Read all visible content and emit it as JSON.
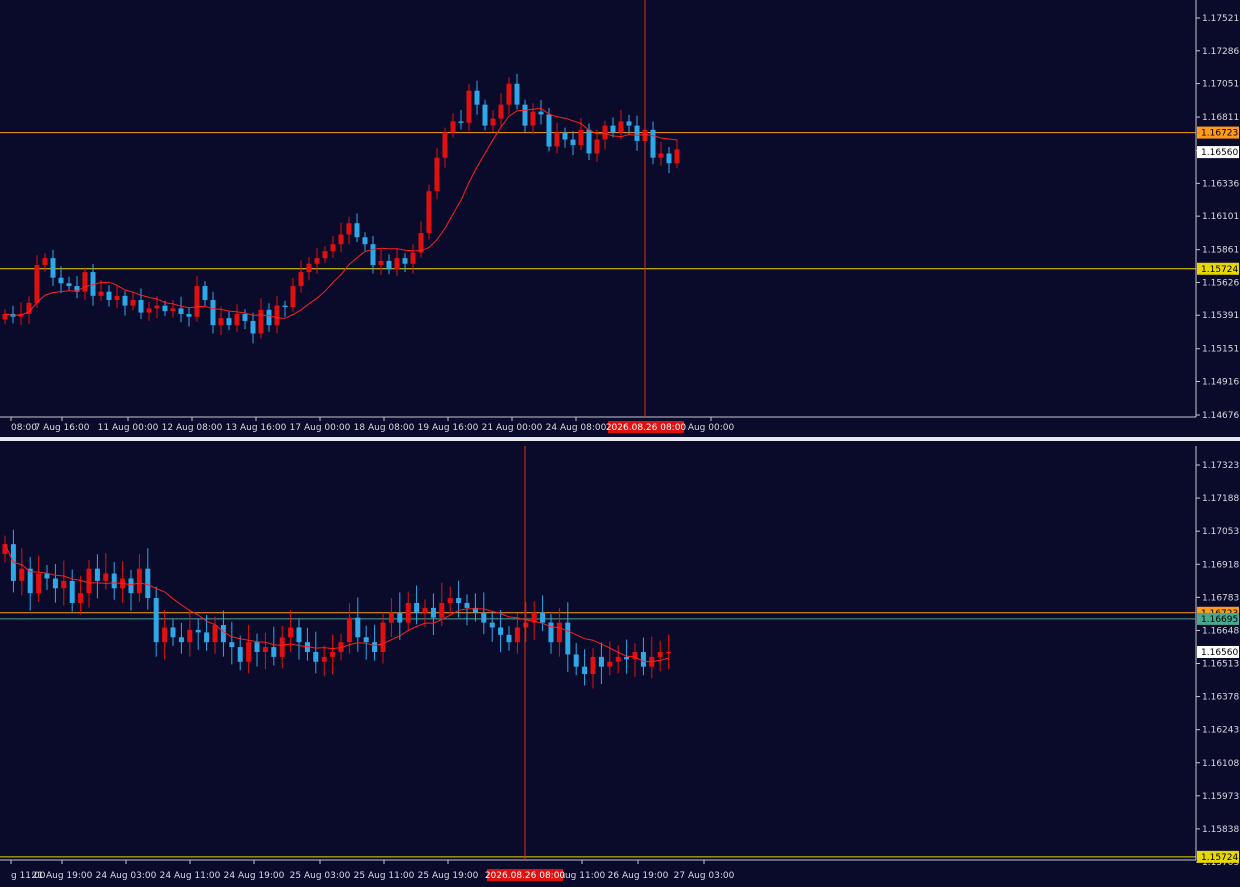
{
  "colors": {
    "background": "#0a0a2a",
    "grid_frame": "#c8c8d0",
    "bull_candle": "#e01010",
    "bear_candle": "#30a8e8",
    "moving_average": "#ff2020",
    "crosshair": "#e03010",
    "level_orange": "#ff9a1a",
    "level_yellow": "#e8d800",
    "level_green": "#4aa890",
    "price_tag_white": "#ffffff",
    "date_tag": "#e01010"
  },
  "chart_data": [
    {
      "type": "candlestick",
      "pane": "top",
      "y_ticks": [
        "1.17521",
        "1.17286",
        "1.17051",
        "1.16811",
        "1.16571",
        "1.16336",
        "1.16101",
        "1.15861",
        "1.15626",
        "1.15391",
        "1.15151",
        "1.14916",
        "1.14676"
      ],
      "ylim": [
        1.14676,
        1.17521
      ],
      "x_ticks": [
        "08:00",
        "7 Aug 16:00",
        "11 Aug 00:00",
        "12 Aug 08:00",
        "13 Aug 16:00",
        "17 Aug 00:00",
        "18 Aug 08:00",
        "19 Aug 16:00",
        "21 Aug 00:00",
        "24 Aug 08:00",
        "Aug 00:00"
      ],
      "crosshair_date": "2026.08.26 08:00",
      "price_tags": [
        {
          "text": "1.16723",
          "color": "orange",
          "level": 1.167
        },
        {
          "text": "1.16560",
          "color": "white",
          "level": 1.1656
        },
        {
          "text": "1.15724",
          "color": "yellow",
          "level": 1.15724
        }
      ],
      "hlines": [
        {
          "level": 1.167,
          "color": "orange"
        },
        {
          "level": 1.15724,
          "color": "yellow"
        }
      ],
      "closes": [
        1.154,
        1.1538,
        1.154,
        1.1548,
        1.1575,
        1.158,
        1.1566,
        1.1562,
        1.156,
        1.1556,
        1.157,
        1.1553,
        1.1556,
        1.155,
        1.1553,
        1.1546,
        1.155,
        1.1541,
        1.1544,
        1.1546,
        1.1542,
        1.1544,
        1.154,
        1.1538,
        1.156,
        1.155,
        1.1532,
        1.1537,
        1.1532,
        1.154,
        1.1535,
        1.1526,
        1.1543,
        1.1532,
        1.1546,
        1.1545,
        1.156,
        1.157,
        1.1576,
        1.158,
        1.1585,
        1.159,
        1.1597,
        1.1605,
        1.1595,
        1.159,
        1.1575,
        1.1578,
        1.1572,
        1.158,
        1.1576,
        1.1584,
        1.1598,
        1.1628,
        1.1652,
        1.167,
        1.1678,
        1.1677,
        1.17,
        1.169,
        1.1675,
        1.168,
        1.169,
        1.1705,
        1.169,
        1.1675,
        1.1685,
        1.1683,
        1.166,
        1.167,
        1.1665,
        1.1661,
        1.1672,
        1.1655,
        1.1665,
        1.1675,
        1.167,
        1.1678,
        1.1675,
        1.1664,
        1.1672,
        1.1652,
        1.1655,
        1.1648,
        1.1658
      ],
      "ma": "20-period moving average (red)"
    },
    {
      "type": "candlestick",
      "pane": "bottom",
      "y_ticks": [
        "1.17323",
        "1.17188",
        "1.17053",
        "1.16918",
        "1.16783",
        "1.16648",
        "1.16513",
        "1.16378",
        "1.16243",
        "1.16108",
        "1.15973",
        "1.15838",
        "1.15703"
      ],
      "ylim": [
        1.15703,
        1.17323
      ],
      "x_ticks": [
        "g 11:00",
        "21 Aug 19:00",
        "24 Aug 03:00",
        "24 Aug 11:00",
        "24 Aug 19:00",
        "25 Aug 03:00",
        "25 Aug 11:00",
        "25 Aug 19:00",
        "Aug 11:00",
        "26 Aug 19:00",
        "27 Aug 03:00"
      ],
      "crosshair_date": "2026.08.26 08:00",
      "price_tags": [
        {
          "text": "1.16723",
          "color": "orange",
          "level": 1.1672
        },
        {
          "text": "1.16695",
          "color": "green",
          "level": 1.16695
        },
        {
          "text": "1.16560",
          "color": "white",
          "level": 1.1656
        },
        {
          "text": "1.15724",
          "color": "yellow",
          "level": 1.15724
        }
      ],
      "hlines": [
        {
          "level": 1.1672,
          "color": "orange"
        },
        {
          "level": 1.16695,
          "color": "green"
        },
        {
          "level": 1.15724,
          "color": "yellow"
        }
      ],
      "closes": [
        1.17,
        1.1685,
        1.169,
        1.168,
        1.1688,
        1.1686,
        1.1682,
        1.1685,
        1.1676,
        1.168,
        1.169,
        1.1685,
        1.1688,
        1.1682,
        1.1686,
        1.168,
        1.169,
        1.1678,
        1.166,
        1.1666,
        1.1662,
        1.166,
        1.1665,
        1.1664,
        1.166,
        1.1667,
        1.166,
        1.1658,
        1.1652,
        1.166,
        1.1656,
        1.1658,
        1.1654,
        1.1662,
        1.1666,
        1.166,
        1.1656,
        1.1652,
        1.1654,
        1.1656,
        1.166,
        1.167,
        1.1662,
        1.166,
        1.1656,
        1.1668,
        1.1672,
        1.1668,
        1.1676,
        1.1672,
        1.1674,
        1.167,
        1.1676,
        1.1678,
        1.1676,
        1.1674,
        1.1672,
        1.1668,
        1.1666,
        1.1663,
        1.166,
        1.1666,
        1.1668,
        1.1672,
        1.1668,
        1.166,
        1.1668,
        1.1655,
        1.165,
        1.1647,
        1.1654,
        1.165,
        1.1652,
        1.1654,
        1.1653,
        1.1656,
        1.165,
        1.1654,
        1.1656,
        1.1656
      ]
    }
  ]
}
